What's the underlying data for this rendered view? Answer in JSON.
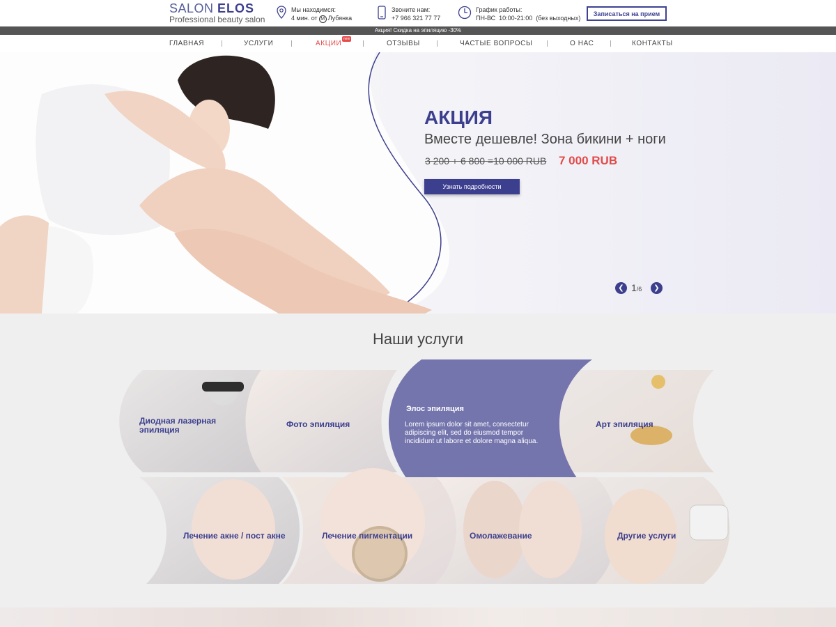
{
  "header": {
    "logo_main_light": "SALON ",
    "logo_main_bold": "ELOS",
    "logo_sub": "Professional beauty salon",
    "location_label": "Мы находимся:",
    "location_value_pre": "4 мин. от",
    "location_metro_icon": "М",
    "location_value_post": "Лубянка",
    "phone_label": "Звоните нам:",
    "phone_value": "+7 966 321 77 77",
    "hours_label": "График работы:",
    "hours_value": "ПН-ВС  10:00-21:00  (без выходных)",
    "book_button": "Записаться на прием"
  },
  "promo_strip": "Акция! Скидка на эпиляцию -30%",
  "nav": {
    "items": [
      "ГЛАВНАЯ",
      "УСЛУГИ",
      "АКЦИИ",
      "ОТЗЫВЫ",
      "ЧАСТЫЕ ВОПРОСЫ",
      "О НАС",
      "КОНТАКТЫ"
    ],
    "active_index": 2,
    "badge": "new"
  },
  "hero": {
    "title": "АКЦИЯ",
    "subtitle": "Вместе дешевле! Зона бикини + ноги",
    "old_price": "3 200 + 6 800 =10 000 RUB",
    "new_price": "7 000 RUB",
    "button": "Узнать подробности",
    "slide_current": "1",
    "slide_total": "/6"
  },
  "services": {
    "title": "Наши услуги",
    "items": [
      "Диодная лазерная эпиляция",
      "Фото эпиляция",
      "Элос эпиляция",
      "Арт эпиляция",
      "Лечение акне / пост акне",
      "Лечение пигментации",
      "Омолажевание",
      "Другие услуги"
    ],
    "featured_text": "Lorem ipsum dolor sit amet, consectetur adipiscing elit, sed do eiusmod tempor incididunt ut labore et dolore magna aliqua."
  },
  "colors": {
    "brand": "#3c3f8e",
    "accent_red": "#e24a4a",
    "promo_bg": "#555555"
  },
  "icons": [
    "location-pin-icon",
    "phone-icon",
    "clock-icon",
    "chevron-left-icon",
    "chevron-right-icon"
  ]
}
